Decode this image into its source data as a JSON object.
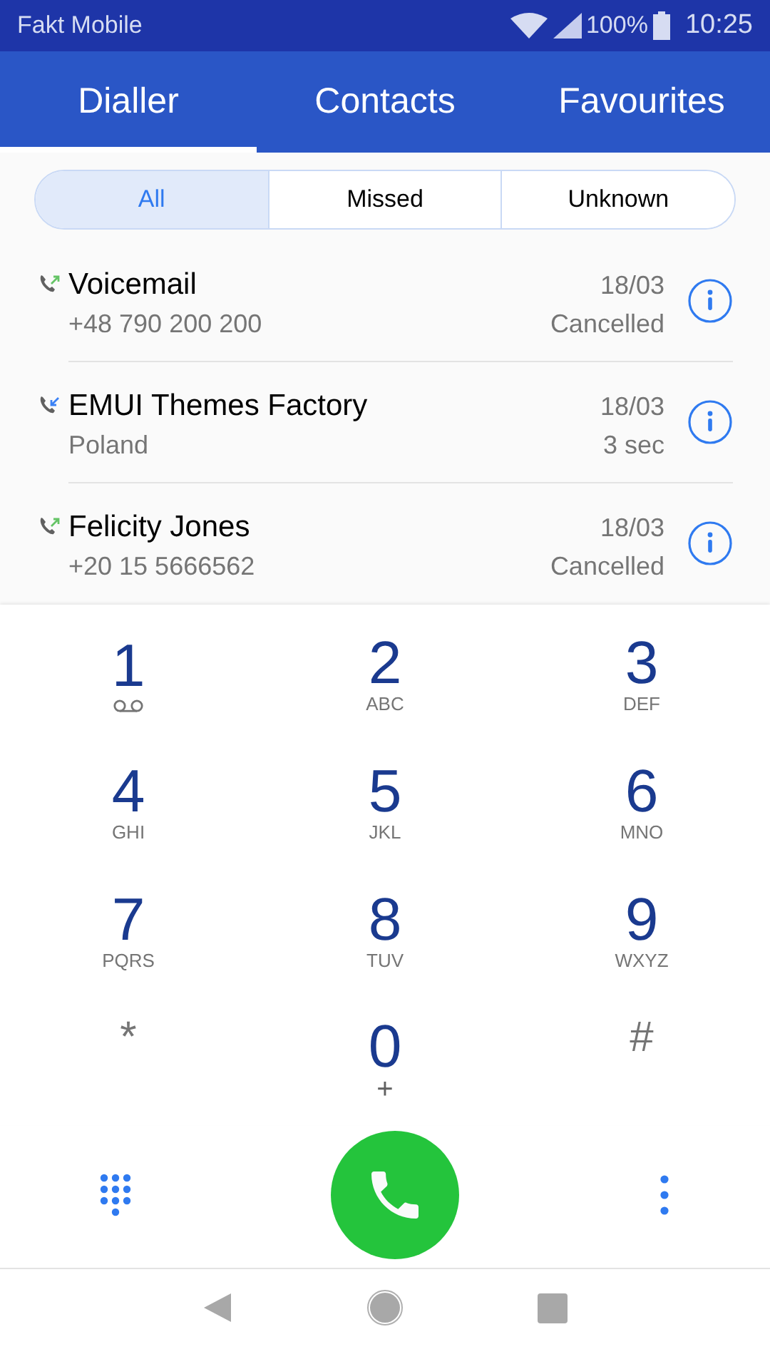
{
  "status_bar": {
    "carrier": "Fakt Mobile",
    "battery": "100%",
    "time": "10:25"
  },
  "tabs": [
    {
      "label": "Dialler",
      "selected": true
    },
    {
      "label": "Contacts",
      "selected": false
    },
    {
      "label": "Favourites",
      "selected": false
    }
  ],
  "filters": [
    {
      "label": "All",
      "selected": true
    },
    {
      "label": "Missed",
      "selected": false
    },
    {
      "label": "Unknown",
      "selected": false
    }
  ],
  "calls": [
    {
      "kind": "outgoing",
      "name": "Voicemail",
      "detail": "+48 790 200 200",
      "date": "18/03",
      "status": "Cancelled"
    },
    {
      "kind": "incoming",
      "name": "EMUI Themes Factory",
      "detail": "Poland",
      "date": "18/03",
      "status": "3 sec"
    },
    {
      "kind": "outgoing",
      "name": "Felicity Jones",
      "detail": "+20 15 5666562",
      "date": "18/03",
      "status": "Cancelled"
    }
  ],
  "keys": [
    {
      "kind": "voicemail",
      "main": "1"
    },
    {
      "kind": "digit",
      "main": "2",
      "sub": "ABC"
    },
    {
      "kind": "digit",
      "main": "3",
      "sub": "DEF"
    },
    {
      "kind": "digit",
      "main": "4",
      "sub": "GHI"
    },
    {
      "kind": "digit",
      "main": "5",
      "sub": "JKL"
    },
    {
      "kind": "digit",
      "main": "6",
      "sub": "MNO"
    },
    {
      "kind": "digit",
      "main": "7",
      "sub": "PQRS"
    },
    {
      "kind": "digit",
      "main": "8",
      "sub": "TUV"
    },
    {
      "kind": "digit",
      "main": "9",
      "sub": "WXYZ"
    },
    {
      "kind": "symbol",
      "main": "*"
    },
    {
      "kind": "digit",
      "main": "0",
      "sub": "+"
    },
    {
      "kind": "symbol",
      "main": "#"
    }
  ]
}
